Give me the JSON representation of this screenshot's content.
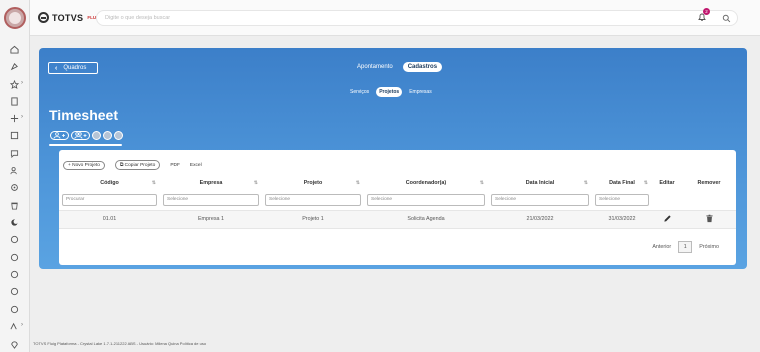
{
  "topbar": {
    "logo_text": "TOTVS",
    "logo_sub": "FLUIG",
    "search_placeholder": "Digite o que deseja buscar",
    "notifications_count": "2"
  },
  "hero": {
    "back_label": "Quadros",
    "tabs": [
      "Apontamento",
      "Cadastros"
    ],
    "active_tab": "Cadastros",
    "subtabs": [
      "Serviços",
      "Projetos",
      "Empresas"
    ],
    "active_subtab": "Projetos",
    "title": "Timesheet"
  },
  "toolbar": {
    "new_label": "+ Novo Projeto",
    "copy_label": "Copiar Projeto",
    "pdf_label": "PDF",
    "excel_label": "Excel"
  },
  "table": {
    "headers": [
      "Código",
      "Empresa",
      "Projeto",
      "Coordenador(a)",
      "Data Inicial",
      "Data Final",
      "Editar",
      "Remover"
    ],
    "filter_placeholders": [
      "Procurar",
      "Selecione",
      "Selecione",
      "Selecione",
      "Selecione",
      "Selecione"
    ],
    "rows": [
      {
        "codigo": "01.01",
        "empresa": "Empresa 1",
        "projeto": "Projeto 1",
        "coordenador": "Solicita Agenda",
        "data_inicial": "21/03/2022",
        "data_final": "31/03/2022"
      }
    ]
  },
  "pagination": {
    "prev_label": "Anterior",
    "page": "1",
    "next_label": "Próximo"
  },
  "footer": {
    "text": "TOTVS Fluig Plataforma - Crystal Lake 1.7.1-211222 ABS - Usuário: Milena Quina    Política de uso"
  },
  "colors": {
    "hero_blue": "#4a8fd6",
    "badge": "#c0186e"
  }
}
